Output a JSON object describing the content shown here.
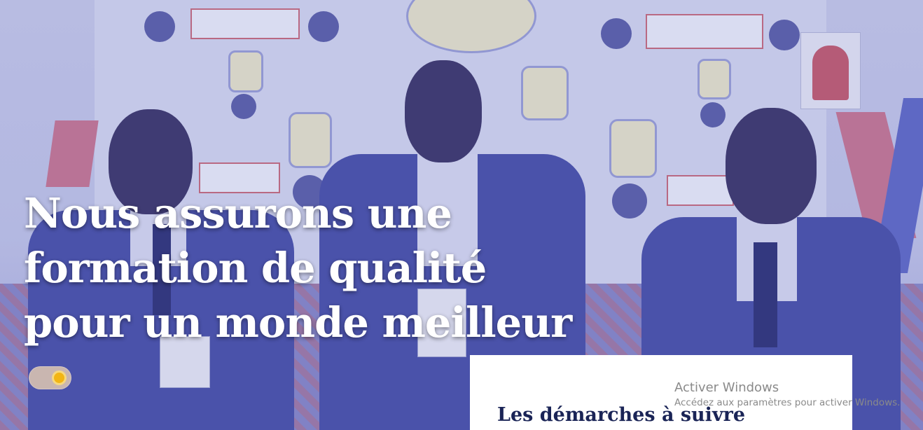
{
  "hero": {
    "title_line1": "Nous assurons une",
    "title_line2": "formation de qualité",
    "title_line3": "pour un monde meilleur",
    "overlay_color": "#5a64c8"
  },
  "theme_toggle": {
    "state": "light",
    "icon": "sun-icon",
    "knob_color": "#f2b514"
  },
  "steps_card": {
    "title": "Les démarches à suivre"
  },
  "activation_watermark": {
    "title": "Activer Windows",
    "subtitle": "Accédez aux paramètres pour activer Windows."
  },
  "colors": {
    "title_text": "#ffffff",
    "card_title": "#1a2456",
    "watermark_text": "#8a8a8a"
  }
}
